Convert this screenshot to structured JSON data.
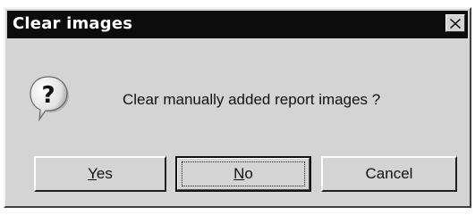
{
  "dialog": {
    "title": "Clear images",
    "message": "Clear manually added report images ?",
    "icon": "question-icon"
  },
  "buttons": {
    "yes": {
      "label_mnemonic": "Y",
      "label_rest": "es"
    },
    "no": {
      "label_mnemonic": "N",
      "label_rest": "o"
    },
    "cancel": {
      "label": "Cancel"
    }
  },
  "titlebar_controls": {
    "close_icon": "close-icon"
  },
  "colors": {
    "titlebar": "#0c0c0c",
    "dialog_bg": "#d4d4d4",
    "title_text": "#ffffff"
  }
}
